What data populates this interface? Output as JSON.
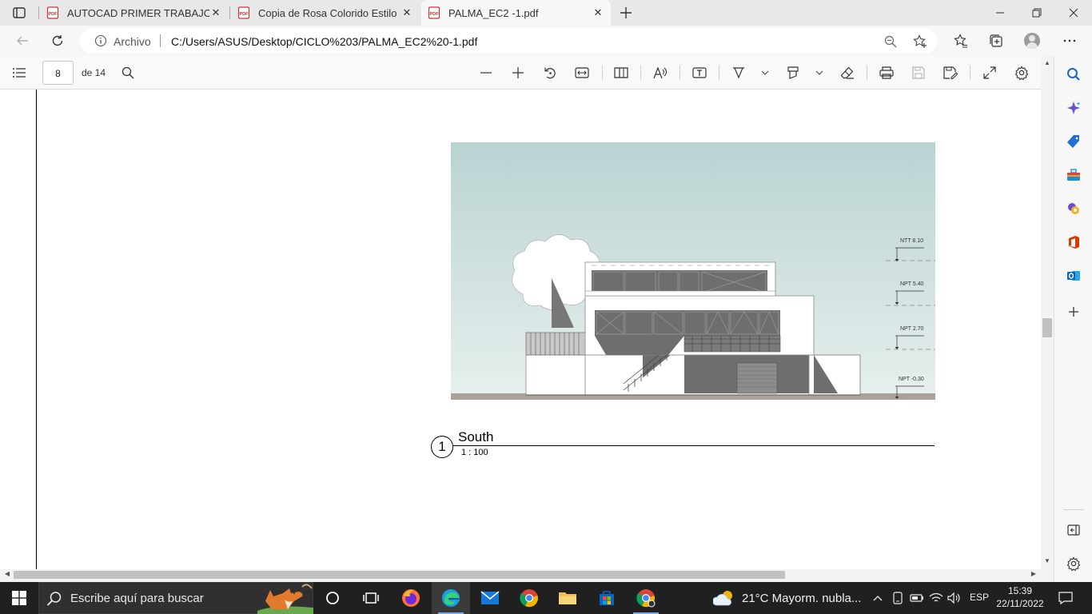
{
  "browser": {
    "tabs": [
      {
        "title": "AUTOCAD PRIMER TRABAJO.pdf",
        "active": false
      },
      {
        "title": "Copia de Rosa Colorido Estilo Se",
        "active": false
      },
      {
        "title": "PALMA_EC2 -1.pdf",
        "active": true
      }
    ],
    "address": {
      "scheme_label": "Archivo",
      "url": "C:/Users/ASUS/Desktop/CICLO%203/PALMA_EC2%20-1.pdf"
    }
  },
  "pdf_toolbar": {
    "page_current": "8",
    "page_total_label": "de 14"
  },
  "document": {
    "view_number": "1",
    "view_title": "South",
    "view_scale": "1 : 100",
    "level_labels": [
      "NTT 8.10",
      "NPT 5.40",
      "NPT 2.70",
      "NPT -0.30"
    ]
  },
  "taskbar": {
    "search_placeholder": "Escribe aquí para buscar",
    "weather_text": "21°C  Mayorm. nubla...",
    "language": "ESP",
    "time": "15:39",
    "date": "22/11/2022"
  },
  "colors": {
    "sky_top": "#b9d3d2",
    "sky_bottom": "#e6efed",
    "ground": "#aaa297",
    "glass": "#6e6e6e",
    "taskbar": "#202020",
    "accent": "#0067c0"
  }
}
